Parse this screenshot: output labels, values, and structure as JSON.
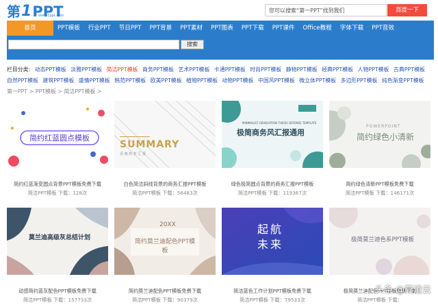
{
  "logo": {
    "part1": "第",
    "part2": "1",
    "part3": "PPT",
    "sub": "www.1ppt.com"
  },
  "top_search": {
    "placeholder": "您可以搜索“第一PPT”找到我们",
    "button": "百度一下"
  },
  "nav": {
    "items": [
      "首页",
      "PPT模板",
      "行业PPT",
      "节日PPT",
      "PPT背景",
      "PPT素材",
      "PPT图表",
      "PPT下载",
      "PPT课件",
      "Office教程",
      "字体下载",
      "PPT音效"
    ]
  },
  "site_search": {
    "button": "搜索"
  },
  "categories": {
    "label": "栏目分类:",
    "row1": [
      "动态PPT模板",
      "淡雅PPT模板",
      "简洁PPT模板",
      "商务PPT模板",
      "艺术PPT模板",
      "卡通PPT模板",
      "时尚PPT模板",
      "静物PPT模板",
      "经典PPT模板",
      "人物PPT模板",
      "古典PPT模板"
    ],
    "row2": [
      "自然PPT模板",
      "建筑PPT模板",
      "盛情PPT模板",
      "韩范PPT模板",
      "欧美PPT模板",
      "植物PPT模板",
      "动物PPT模板",
      "中国风PPT模板",
      "微立体PPT模板",
      "多边形PPT模板",
      "纯色渐变PPT模板"
    ]
  },
  "breadcrumb": "第一PPT > PPT模板 > 简洁PPT模板 >",
  "cards": [
    {
      "title": "简约红蓝渐变圆点背景PPT模板免费下载",
      "meta": "简洁PPT模板  下载：128次",
      "thumb_text": "简约红蓝圆点模板"
    },
    {
      "title": "白色简洁斜线背景的商务汇报PPT模板",
      "meta": "简洁PPT模板  下载：56483次",
      "thumb_text": "SUMMARY",
      "thumb_sub": "清 雨 商 务 汇 报"
    },
    {
      "title": "绿色极简圆点背景的商务汇报PPT模板",
      "meta": "简洁PPT模板  下载：119367次",
      "thumb_text": "极简商务风汇报通用",
      "thumb_sub": "MINIMALIST GRADUATION THESIS DEFENSE TEMPLATE"
    },
    {
      "title": "简约绿色清新PPT模板免费下载",
      "meta": "简洁PPT模板  下载：146171次",
      "thumb_text": "简约绿色小清新",
      "thumb_sub": "POWERPOINT"
    },
    {
      "title": "动感简约蓝灰配色PPT模板免费下载",
      "meta": "简洁PPT模板  下载：157733次",
      "thumb_text": "莫兰迪高级灰总结计划"
    },
    {
      "title": "简约莫兰迪配色PPT模板免费下载",
      "meta": "简洁PPT模板  下载：90379次",
      "thumb_text": "简约莫兰迪配色PPT模板",
      "thumb_sub": "20XX"
    },
    {
      "title": "简洁蓝色工作计划PPT模板免费下载",
      "meta": "简洁PPT模板  下载：79533次",
      "thumb_text": "起航",
      "thumb_sub": "未来"
    },
    {
      "title": "极简莫兰迪配色PPT模板免费下载",
      "meta": "简洁PPT模板  下载：",
      "thumb_text": "极简莫兰迪色系PPT模板"
    }
  ],
  "watermark": "头条 @简道云",
  "colors": {
    "nav": "#2b7dcc",
    "active": "#f39826",
    "search_btn": "#f24b3c",
    "link": "#2a55b5",
    "active_link": "#e5452c"
  }
}
